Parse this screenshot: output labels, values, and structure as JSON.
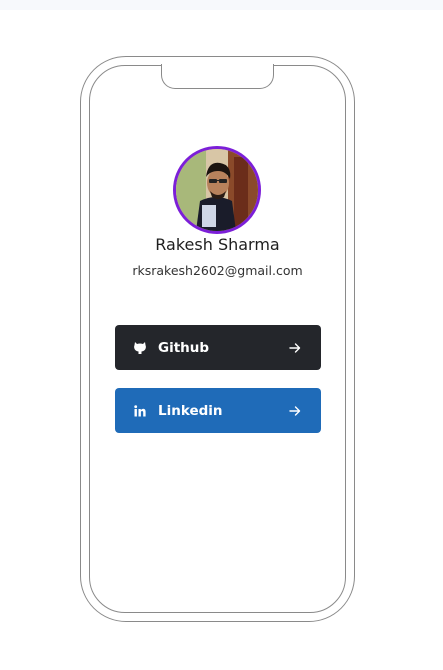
{
  "profile": {
    "name": "Rakesh Sharma",
    "email": "rksrakesh2602@gmail.com",
    "avatar_icon": "avatar-photo",
    "avatar_ring_color": "#7c1fd8"
  },
  "links": [
    {
      "label": "Github",
      "icon": "github-icon",
      "arrow_icon": "arrow-right-icon",
      "background": "#24262b"
    },
    {
      "label": "Linkedin",
      "icon": "linkedin-icon",
      "arrow_icon": "arrow-right-icon",
      "background": "#1f6bb8"
    }
  ]
}
